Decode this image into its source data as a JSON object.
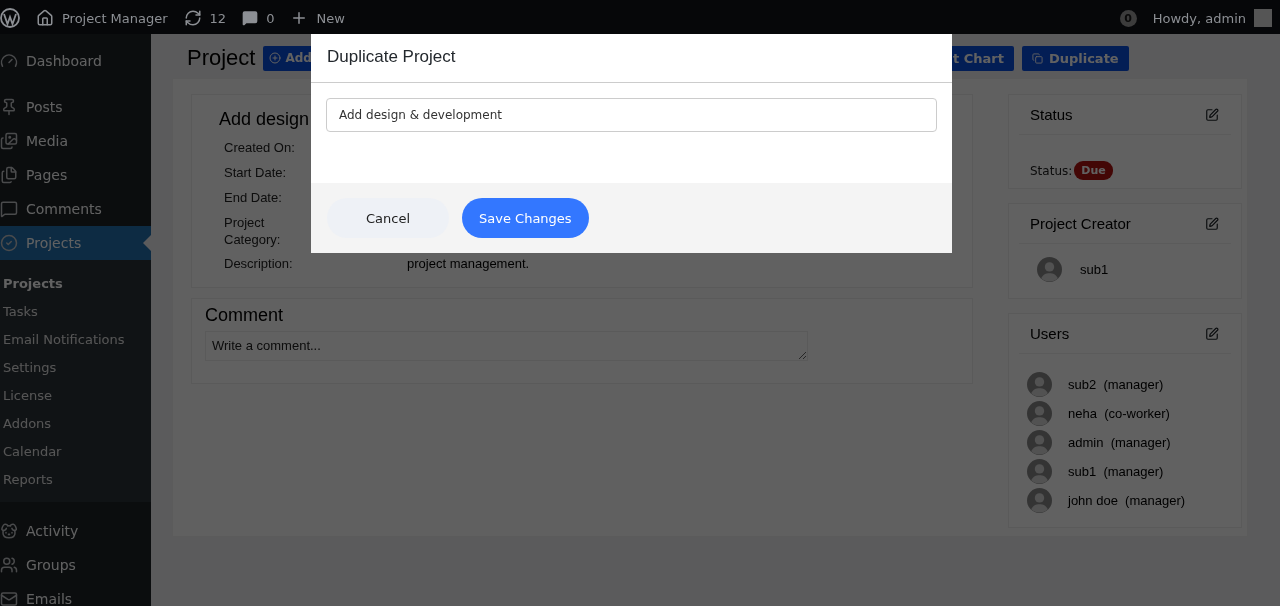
{
  "admin_bar": {
    "site": "Project Manager",
    "updates": "12",
    "comments": "0",
    "new": "New",
    "notifications": "0",
    "greeting": "Howdy, admin"
  },
  "sidebar": {
    "items": [
      {
        "label": "Dashboard",
        "selected": false
      },
      {
        "label": "Posts",
        "selected": false
      },
      {
        "label": "Media",
        "selected": false
      },
      {
        "label": "Pages",
        "selected": false
      },
      {
        "label": "Comments",
        "selected": false
      },
      {
        "label": "Projects",
        "selected": true,
        "children": [
          {
            "label": "Projects",
            "selected": true
          },
          {
            "label": "Tasks",
            "selected": false
          },
          {
            "label": "Email Notifications",
            "selected": false
          },
          {
            "label": "Settings",
            "selected": false
          },
          {
            "label": "License",
            "selected": false
          },
          {
            "label": "Addons",
            "selected": false
          },
          {
            "label": "Calendar",
            "selected": false
          },
          {
            "label": "Reports",
            "selected": false
          }
        ]
      },
      {
        "label": "Activity",
        "selected": false
      },
      {
        "label": "Groups",
        "selected": false
      },
      {
        "label": "Emails",
        "selected": false
      }
    ]
  },
  "page": {
    "title": "Project",
    "buttons": [
      {
        "label": "Add"
      },
      {
        "label": "t Chart"
      },
      {
        "label": "Duplicate"
      }
    ]
  },
  "project_card": {
    "heading": "Add design",
    "fields": [
      {
        "label": "Created On:"
      },
      {
        "label": "Start Date:"
      },
      {
        "label": "End Date:"
      },
      {
        "label": "Project Category:"
      },
      {
        "label": "Description:",
        "value": "project management."
      }
    ]
  },
  "comment": {
    "title": "Comment",
    "placeholder": "Write a comment..."
  },
  "status_card": {
    "title": "Status",
    "label": "Status:",
    "badge": "Due"
  },
  "creator_card": {
    "title": "Project Creator",
    "user": "sub1"
  },
  "users_card": {
    "title": "Users",
    "users": [
      {
        "name": "sub2",
        "role": "(manager)"
      },
      {
        "name": "neha",
        "role": "(co-worker)"
      },
      {
        "name": "admin",
        "role": "(manager)"
      },
      {
        "name": "sub1",
        "role": "(manager)"
      },
      {
        "name": "john doe",
        "role": "(manager)"
      }
    ]
  },
  "modal": {
    "title": "Duplicate Project",
    "value": "Add design & development",
    "buttons": [
      {
        "label": "Cancel",
        "kind": "secondary"
      },
      {
        "label": "Save Changes",
        "kind": "primary"
      }
    ]
  }
}
